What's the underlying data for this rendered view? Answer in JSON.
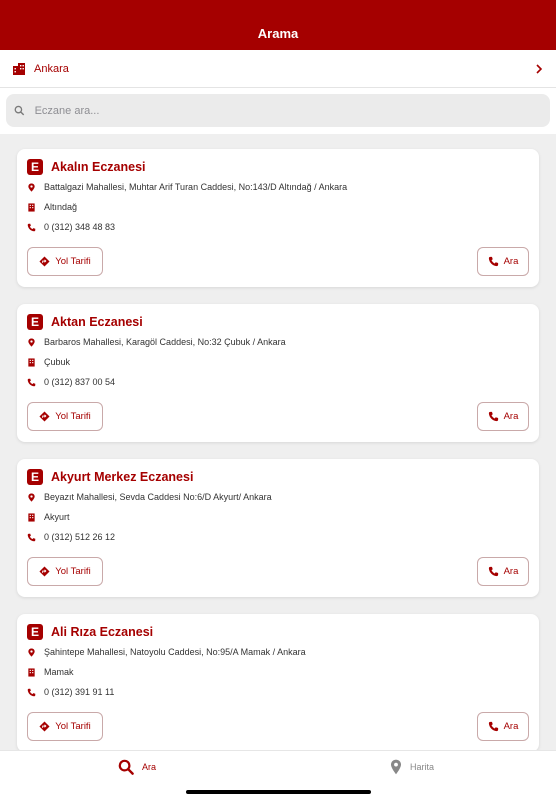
{
  "header": {
    "title": "Arama"
  },
  "city": {
    "name": "Ankara"
  },
  "search": {
    "placeholder": "Eczane ara..."
  },
  "pharmacies": [
    {
      "name": "Akalın Eczanesi",
      "address": "Battalgazi Mahallesi, Muhtar Arif Turan Caddesi, No:143/D Altındağ / Ankara",
      "district": "Altındağ",
      "phone": "0 (312) 348 48 83"
    },
    {
      "name": "Aktan Eczanesi",
      "address": "Barbaros Mahallesi, Karagöl Caddesi, No:32 Çubuk / Ankara",
      "district": "Çubuk",
      "phone": "0 (312) 837 00 54"
    },
    {
      "name": "Akyurt Merkez Eczanesi",
      "address": "Beyazıt Mahallesi, Sevda Caddesi No:6/D Akyurt/ Ankara",
      "district": "Akyurt",
      "phone": "0 (312) 512 26 12"
    },
    {
      "name": "Ali Rıza Eczanesi",
      "address": "Şahintepe Mahallesi, Natoyolu Caddesi, No:95/A Mamak / Ankara",
      "district": "Mamak",
      "phone": "0 (312) 391 91 11"
    }
  ],
  "card_actions": {
    "directions_label": "Yol Tarifi",
    "call_label": "Ara"
  },
  "logo_letter": "E",
  "tabs": {
    "search_label": "Ara",
    "map_label": "Harita"
  },
  "colors": {
    "accent": "#a50000",
    "background": "#efefef"
  },
  "icons": [
    "building-icon",
    "chevron-right-icon",
    "search-icon",
    "pin-icon",
    "phone-icon",
    "direction-icon",
    "map-pin-icon"
  ]
}
